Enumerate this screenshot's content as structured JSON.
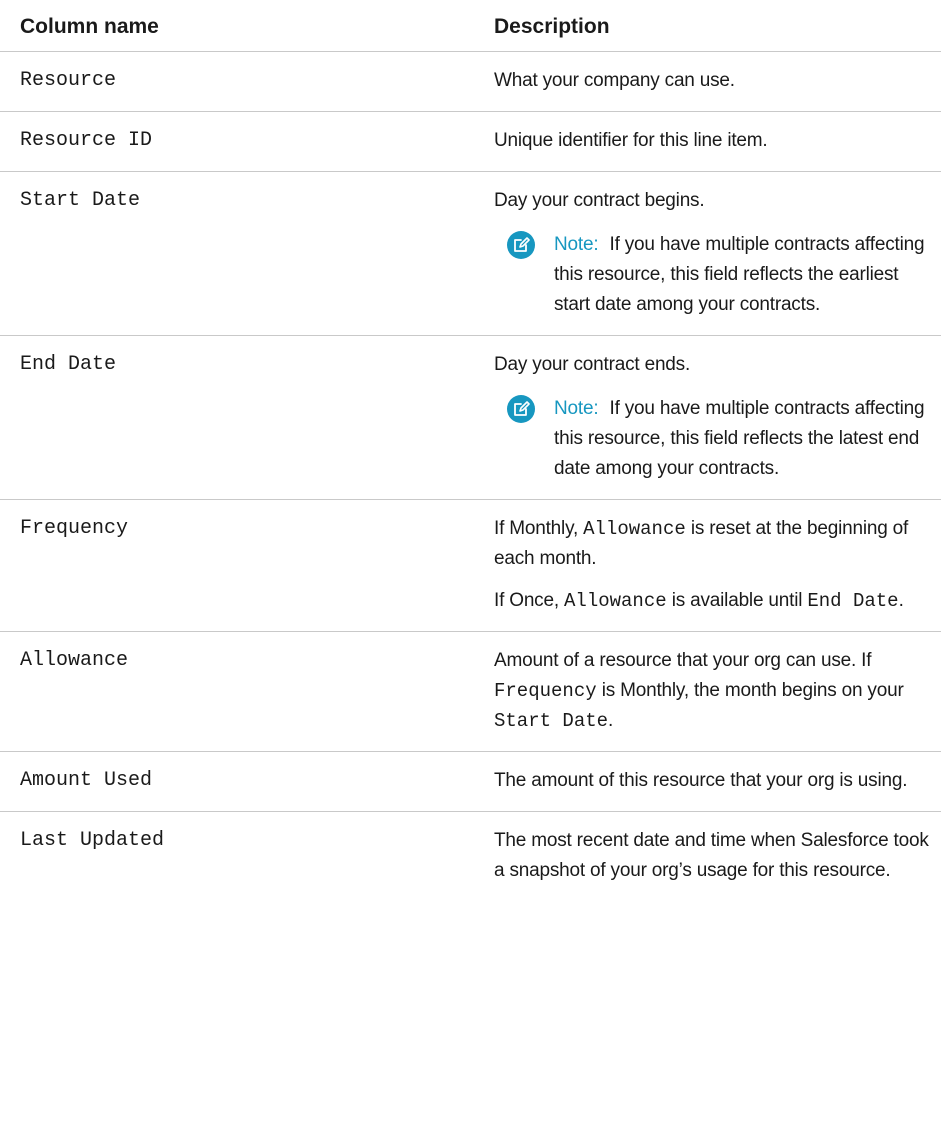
{
  "table": {
    "headers": {
      "name": "Column name",
      "description": "Description"
    },
    "rows": [
      {
        "name": "Resource",
        "description": "What your company can use."
      },
      {
        "name": "Resource ID",
        "description": "Unique identifier for this line item."
      },
      {
        "name": "Start Date",
        "description": "Day your contract begins.",
        "note_label": "Note:",
        "note_text": "If you have multiple contracts affecting this resource, this field reflects the earliest start date among your contracts."
      },
      {
        "name": "End Date",
        "description": "Day your contract ends.",
        "note_label": "Note:",
        "note_text": "If you have multiple contracts affecting this resource, this field reflects the latest end date among your contracts."
      },
      {
        "name": "Frequency",
        "p1": {
          "a": "If Monthly, ",
          "code": "Allowance",
          "b": " is reset at the beginning of each month."
        },
        "p2": {
          "a": "If Once, ",
          "code1": "Allowance",
          "b": " is available until ",
          "code2": "End Date",
          "c": "."
        }
      },
      {
        "name": "Allowance",
        "p1": {
          "a": "Amount of a resource that your org can use. If ",
          "code1": "Frequency",
          "b": " is Monthly, the month begins on your ",
          "code2": "Start Date",
          "c": "."
        }
      },
      {
        "name": "Amount Used",
        "description": "The amount of this resource that your org is using."
      },
      {
        "name": "Last Updated",
        "description": "The most recent date and time when Salesforce took a snapshot of your org’s usage for this resource."
      }
    ]
  },
  "icons": {
    "note": "edit-note-icon"
  },
  "colors": {
    "note_accent": "#1797c0",
    "divider": "#c9c9c9"
  }
}
